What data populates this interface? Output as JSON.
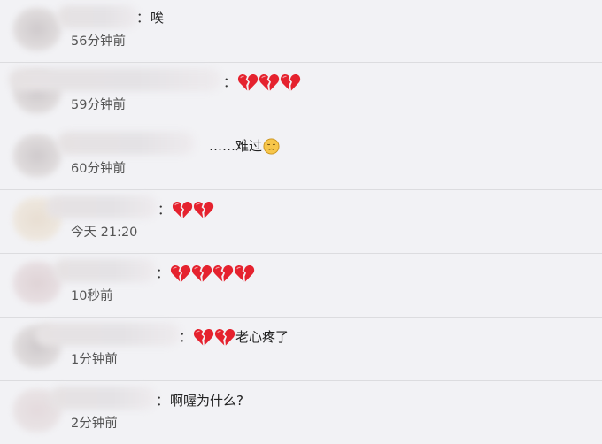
{
  "comments": [
    {
      "text": "唉",
      "hearts": 0,
      "emoji": "",
      "time": "56分钟前",
      "prefix": ""
    },
    {
      "text": "",
      "hearts": 3,
      "emoji": "",
      "time": "59分钟前",
      "prefix": ""
    },
    {
      "text": "难过",
      "hearts": 0,
      "emoji": "sad-face-icon",
      "time": "60分钟前",
      "prefix": "……"
    },
    {
      "text": "",
      "hearts": 2,
      "emoji": "",
      "time": "今天 21:20",
      "prefix": ""
    },
    {
      "text": "",
      "hearts": 4,
      "emoji": "",
      "time": "10秒前",
      "prefix": ""
    },
    {
      "text": "老心疼了",
      "hearts": 2,
      "emoji": "",
      "time": "1分钟前",
      "prefix": ""
    },
    {
      "text": "啊喔为什么?",
      "hearts": 0,
      "emoji": "",
      "time": "2分钟前",
      "prefix": ""
    }
  ],
  "separator": "：",
  "icons": {
    "heart": "broken-heart-icon",
    "sad": "sad-face-icon"
  },
  "colors": {
    "heart": "#e5222e",
    "background": "#f2f2f5"
  }
}
